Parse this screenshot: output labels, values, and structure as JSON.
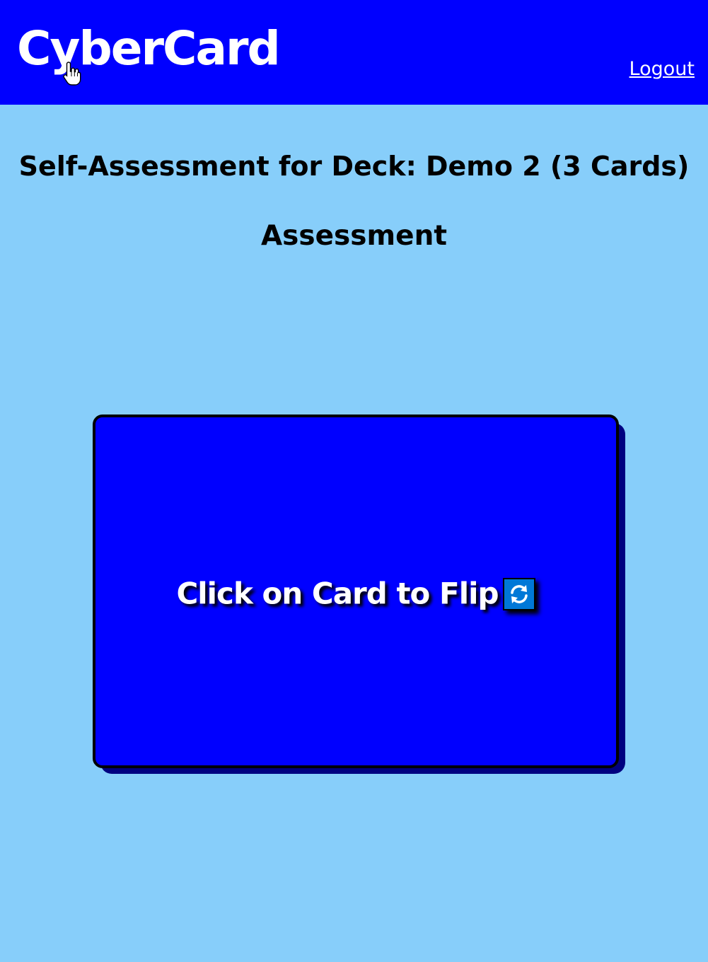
{
  "header": {
    "brand": "CyberCard",
    "logout_label": "Logout"
  },
  "page": {
    "title": "Self-Assessment for Deck: Demo 2 (3 Cards)",
    "section_title": "Assessment"
  },
  "card": {
    "prompt": "Click on Card to Flip",
    "icon": "flip-arrows-icon"
  },
  "colors": {
    "header_bg": "#0000ff",
    "page_bg": "#87cefa",
    "card_bg": "#0000ff",
    "card_shadow": "#000080",
    "icon_bg": "#0078d7"
  }
}
